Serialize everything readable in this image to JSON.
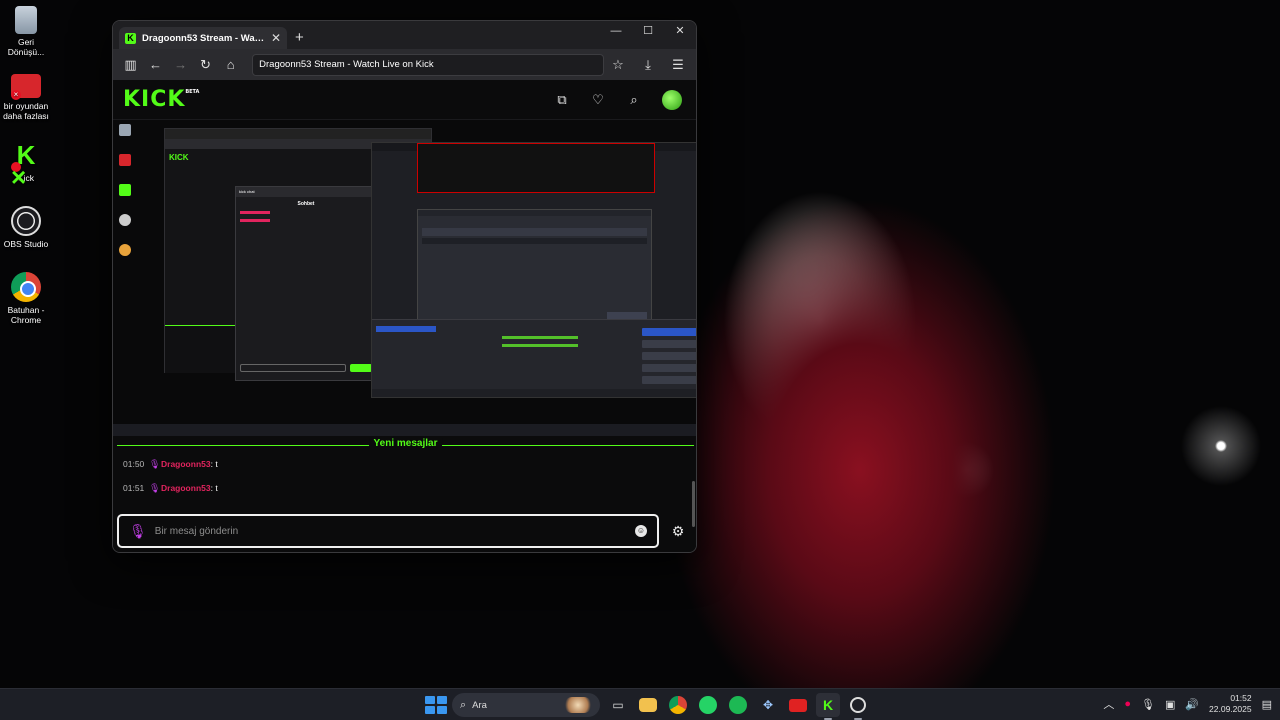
{
  "desktop": {
    "icons": [
      {
        "label": "Geri Dönüşü...",
        "icon": "recycle-bin-icon"
      },
      {
        "label": "bir oyundan daha fazlası",
        "icon": "folder-icon"
      },
      {
        "label": "Kick",
        "icon": "kick-icon"
      },
      {
        "label": "OBS Studio",
        "icon": "obs-icon"
      },
      {
        "label": "Batuhan - Chrome",
        "icon": "chrome-icon"
      }
    ]
  },
  "browser": {
    "tab_title": "Dragoonn53 Stream - Watc...",
    "tab_favicon": "K",
    "url": "Dragoonn53 Stream - Watch Live on Kick",
    "new_tab": "+",
    "min": "—",
    "max": "☐",
    "close": "✕"
  },
  "kick": {
    "logo": "KICK",
    "beta": "BETA",
    "brand_color": "#53fc18"
  },
  "stream_preview": {
    "inner_chat_title": "Sohbet",
    "inner_chat_header": "kick chat"
  },
  "chat": {
    "new_messages_label": "Yeni mesajlar",
    "messages": [
      {
        "time": "01:50",
        "user": "Dragoonn53",
        "text": ": t"
      },
      {
        "time": "01:51",
        "user": "Dragoonn53",
        "text": ": t"
      }
    ],
    "input_placeholder": "Bir mesaj gönderin",
    "username_color": "#e2245e",
    "mic_color": "#c23fe6"
  },
  "taskbar": {
    "search_label": "Ara",
    "time": "01:52",
    "date": "22.09.2025"
  }
}
